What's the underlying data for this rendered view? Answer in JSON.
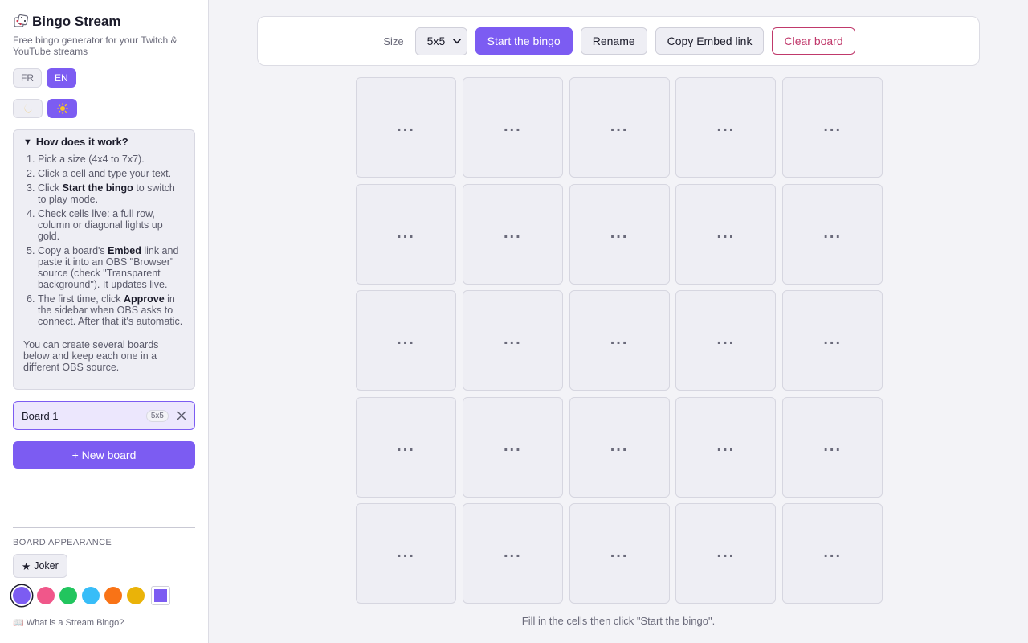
{
  "app": {
    "title": "Bingo Stream",
    "subtitle": "Free bingo generator for your Twitch & YouTube streams"
  },
  "language": {
    "options": [
      "FR",
      "EN"
    ],
    "selected": "EN"
  },
  "theme": {
    "options": [
      "moon-icon",
      "sun-icon"
    ],
    "selected": "sun-icon"
  },
  "help": {
    "summary": "How does it work?",
    "steps": [
      {
        "num": "1.",
        "parts": [
          "Pick a size (4x4 to 7x7)."
        ]
      },
      {
        "num": "2.",
        "parts": [
          "Click a cell and type your text."
        ]
      },
      {
        "num": "3.",
        "parts": [
          "Click ",
          "Start the bingo",
          " to switch to play mode."
        ]
      },
      {
        "num": "4.",
        "parts": [
          "Check cells live: a full row, column or diagonal lights up gold."
        ]
      },
      {
        "num": "5.",
        "parts": [
          "Copy a board's ",
          "Embed",
          " link and paste it into an OBS \"Browser\" source (check \"Transparent background\"). It updates live."
        ]
      },
      {
        "num": "6.",
        "parts": [
          "The first time, click ",
          "Approve",
          " in the sidebar when OBS asks to connect. After that it's automatic."
        ]
      }
    ],
    "note": "You can create several boards below and keep each one in a different OBS source."
  },
  "boards": {
    "items": [
      {
        "name": "Board 1",
        "size": "5x5"
      }
    ],
    "new_label": "+ New board"
  },
  "appearance": {
    "label": "BOARD APPEARANCE",
    "joker_label": "Joker",
    "colors": [
      "#7c5cf2",
      "#f0578a",
      "#22c55e",
      "#38bdf8",
      "#f97316",
      "#eab308"
    ],
    "selected_color": "#7c5cf2",
    "custom_color": "#7c5cf2"
  },
  "footer": {
    "link": "What is a Stream Bingo?"
  },
  "toolbar": {
    "size_label": "Size",
    "size_value": "5x5",
    "start_label": "Start the bingo",
    "rename_label": "Rename",
    "embed_label": "Copy Embed link",
    "clear_label": "Clear board"
  },
  "grid": {
    "rows": 5,
    "cols": 5,
    "placeholder": "..."
  },
  "hint": "Fill in the cells then click \"Start the bingo\"."
}
